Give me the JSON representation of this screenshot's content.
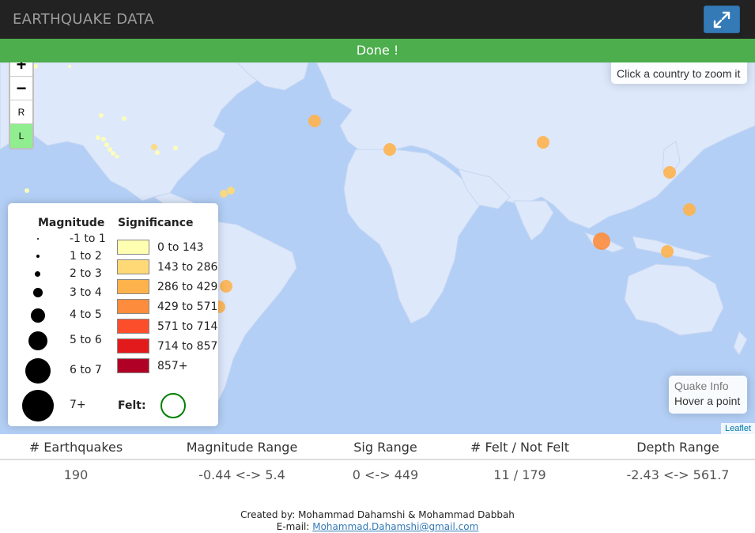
{
  "app": {
    "title": "EARTHQUAKE DATA"
  },
  "status": {
    "text": "Done !"
  },
  "map": {
    "zoom_in_label": "+",
    "zoom_out_label": "−",
    "reset_label": "R",
    "layer_label": "L",
    "info_top_text": "Click a country to zoom it",
    "quake_info_title": "Quake Info",
    "quake_info_text": "Hover a point",
    "attribution": "Leaflet"
  },
  "legend": {
    "magnitude_title": "Magnitude",
    "significance_title": "Significance",
    "magnitude_items": [
      "-1 to 1",
      "1 to 2",
      "2 to 3",
      "3 to 4",
      "4 to 5",
      "5 to 6",
      "6 to 7",
      "7+"
    ],
    "significance_items": [
      {
        "label": "0 to 143",
        "color": "#ffffb2"
      },
      {
        "label": "143 to 286",
        "color": "#fed976"
      },
      {
        "label": "286 to 429",
        "color": "#feb24c"
      },
      {
        "label": "429 to 571",
        "color": "#fd8d3c"
      },
      {
        "label": "571 to 714",
        "color": "#fc4e2a"
      },
      {
        "label": "714 to 857",
        "color": "#e31a1c"
      },
      {
        "label": "857+",
        "color": "#b10026"
      }
    ],
    "felt_label": "Felt:",
    "felt_color": "#008000"
  },
  "stats": {
    "headers": [
      "# Earthquakes",
      "Magnitude Range",
      "Sig Range",
      "# Felt / Not Felt",
      "Depth Range"
    ],
    "values": [
      "190",
      "-0.44 <-> 5.4",
      "0 <-> 449",
      "11 / 179",
      "-2.43 <-> 561.7"
    ]
  },
  "footer": {
    "created_by": "Created by: Mohammad Dahamshi & Mohammad Dabbah",
    "email_label": "E-mail:",
    "email": "Mohammad.Dahamshi@gmail.com"
  },
  "colors": {
    "navbar": "#222222",
    "status_bar": "#4cae4c",
    "ocean": "#b3cff5",
    "land": "#dde8fb",
    "accent": "#337ab7"
  }
}
